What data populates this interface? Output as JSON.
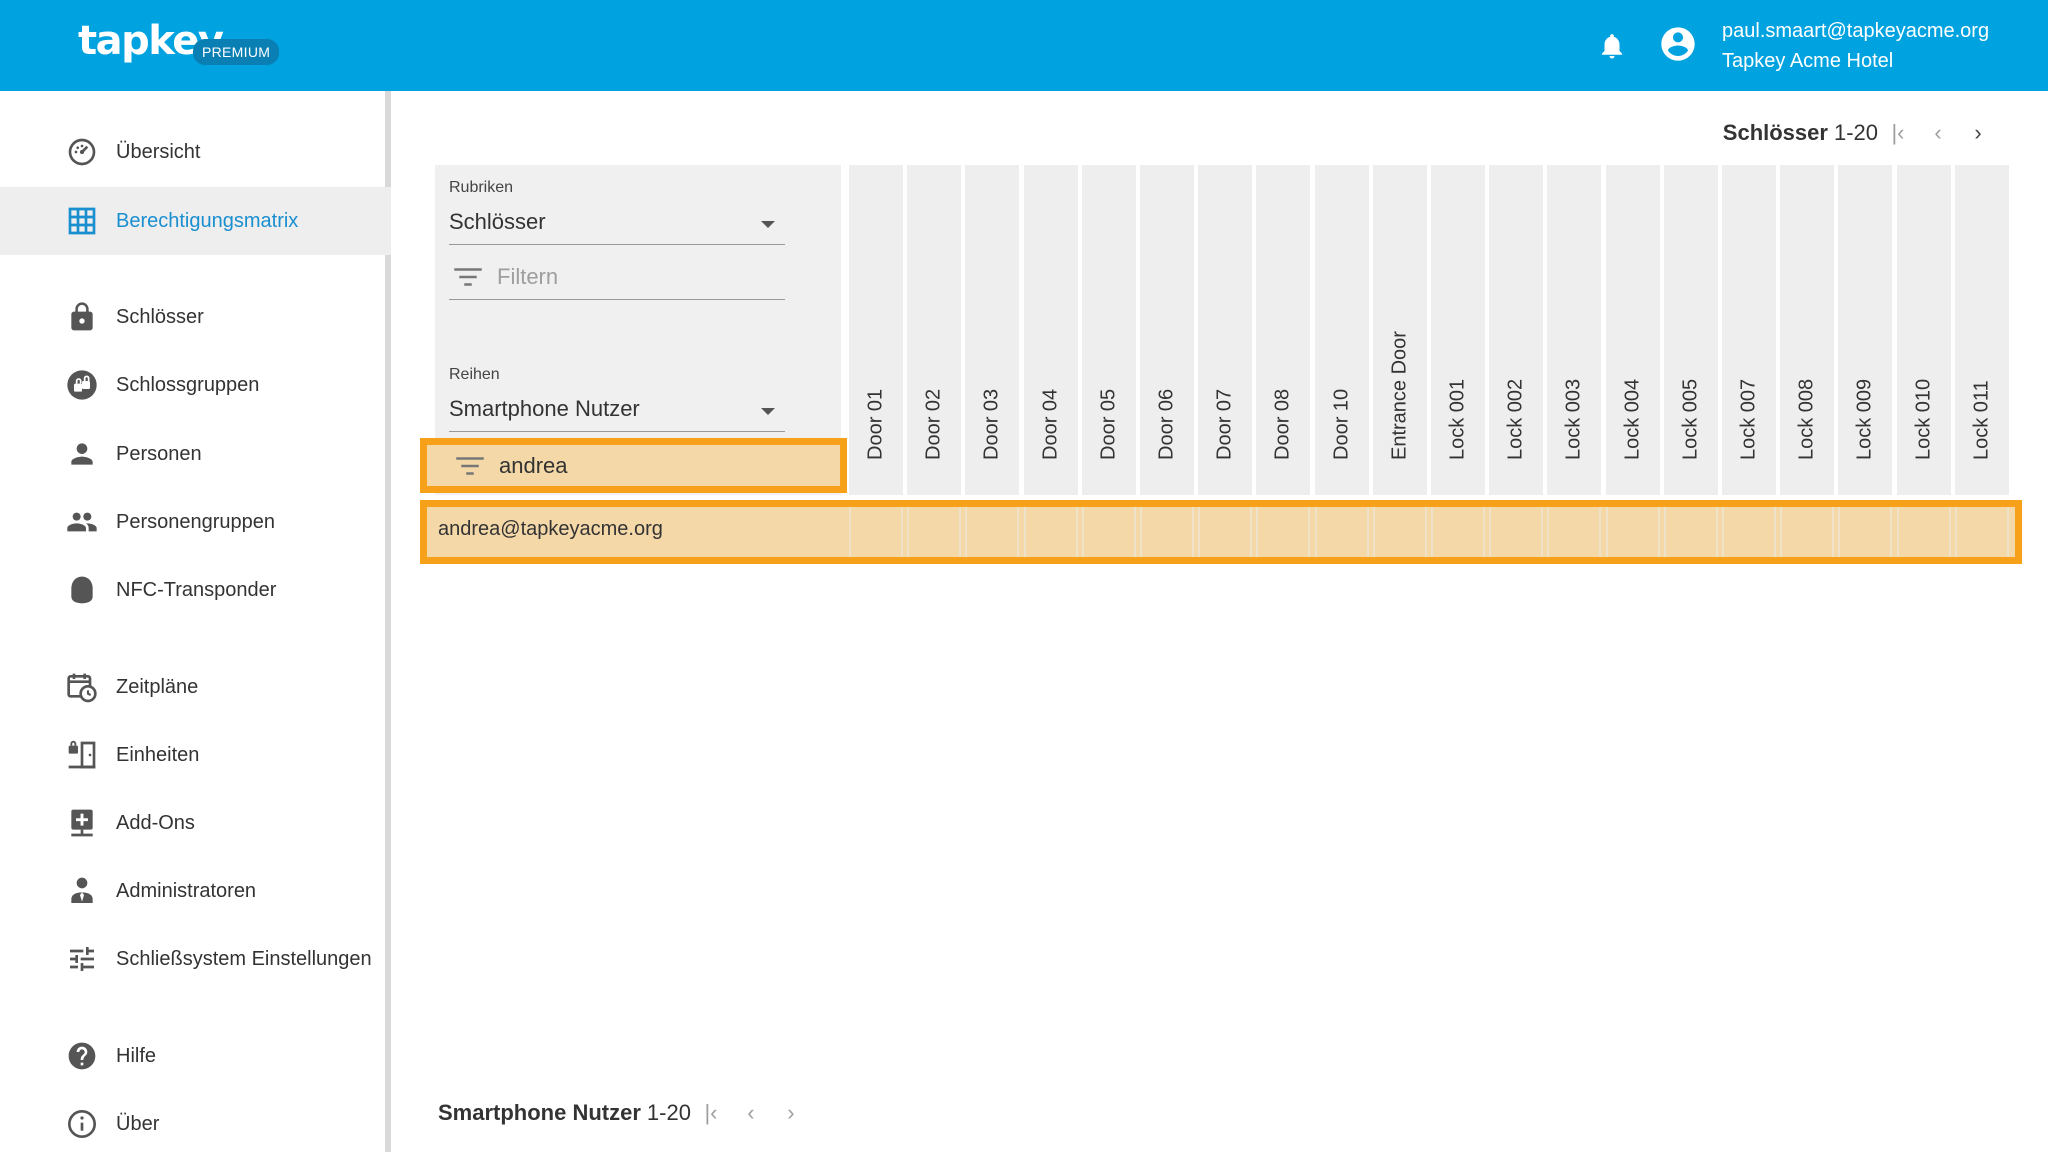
{
  "header": {
    "logo": "tapkey",
    "badge": "PREMIUM",
    "user_email": "paul.smaart@tapkeyacme.org",
    "user_org": "Tapkey Acme Hotel",
    "icons": [
      "bell-icon",
      "account-circle-icon"
    ]
  },
  "sidebar": {
    "items": [
      {
        "label": "Übersicht",
        "icon": "dashboard-icon"
      },
      {
        "label": "Berechtigungsmatrix",
        "icon": "grid-icon",
        "active": true
      },
      {
        "label": "Schlösser",
        "icon": "lock-icon"
      },
      {
        "label": "Schlossgruppen",
        "icon": "lock-group-icon"
      },
      {
        "label": "Personen",
        "icon": "person-icon"
      },
      {
        "label": "Personengruppen",
        "icon": "people-icon"
      },
      {
        "label": "NFC-Transponder",
        "icon": "nfc-transponder-icon"
      },
      {
        "label": "Zeitpläne",
        "icon": "schedule-icon"
      },
      {
        "label": "Einheiten",
        "icon": "units-icon"
      },
      {
        "label": "Add-Ons",
        "icon": "add-ons-icon"
      },
      {
        "label": "Administratoren",
        "icon": "admin-icon"
      },
      {
        "label": "Schließsystem Einstellungen",
        "icon": "settings-sliders-icon"
      },
      {
        "label": "Hilfe",
        "icon": "help-icon"
      },
      {
        "label": "Über",
        "icon": "info-icon"
      }
    ]
  },
  "matrix": {
    "columns_pager": {
      "label": "Schlösser",
      "range": "1-20"
    },
    "rows_pager": {
      "label": "Smartphone Nutzer",
      "range": "1-20"
    },
    "rubriken": {
      "label": "Rubriken",
      "value": "Schlösser",
      "filter_placeholder": "Filtern"
    },
    "reihen": {
      "label": "Reihen",
      "value": "Smartphone Nutzer",
      "filter_value": "andrea"
    },
    "columns": [
      "Door 01",
      "Door 02",
      "Door 03",
      "Door 04",
      "Door 05",
      "Door 06",
      "Door 07",
      "Door 08",
      "Door 10",
      "Entrance Door",
      "Lock 001",
      "Lock 002",
      "Lock 003",
      "Lock 004",
      "Lock 005",
      "Lock 007",
      "Lock 008",
      "Lock 009",
      "Lock 010",
      "Lock 011"
    ],
    "rows": [
      {
        "name": "andrea@tapkeyacme.org"
      }
    ],
    "highlight_color": "#f7a11a"
  },
  "colors": {
    "brand": "#00a3e0",
    "active_nav": "#1a8fd0"
  }
}
